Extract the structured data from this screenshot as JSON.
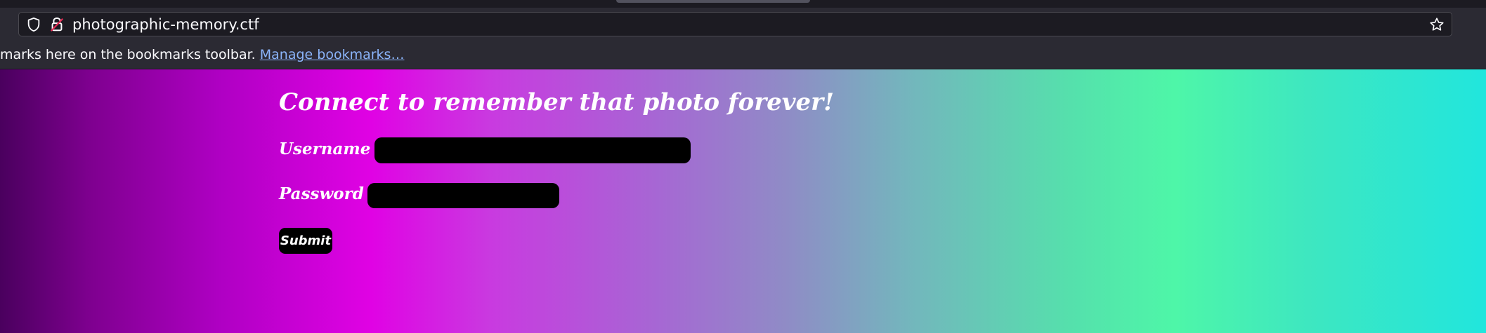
{
  "browser": {
    "url": "photographic-memory.ctf",
    "bookmarks_toolbar_text": "marks here on the bookmarks toolbar.",
    "bookmarks_toolbar_link": "Manage bookmarks…"
  },
  "page": {
    "title": "Connect to remember that photo forever!",
    "username_label": "Username",
    "username_value": "",
    "password_label": "Password",
    "password_value": "",
    "submit_label": "Submit"
  },
  "colors": {
    "gradient": [
      "#4a005e",
      "#7e008f",
      "#b000c4",
      "#e002e4",
      "#c93ae0",
      "#a766d4",
      "#8f8cc6",
      "#74b5bd",
      "#55e0ac",
      "#4ef6a8",
      "#3ee7c0",
      "#21e6dd"
    ],
    "field_background": "#000000",
    "text": "#ffffff",
    "link": "#8bb4fa"
  },
  "icons": [
    "shield-icon",
    "insecure-lock-icon",
    "bookmark-star-icon"
  ]
}
